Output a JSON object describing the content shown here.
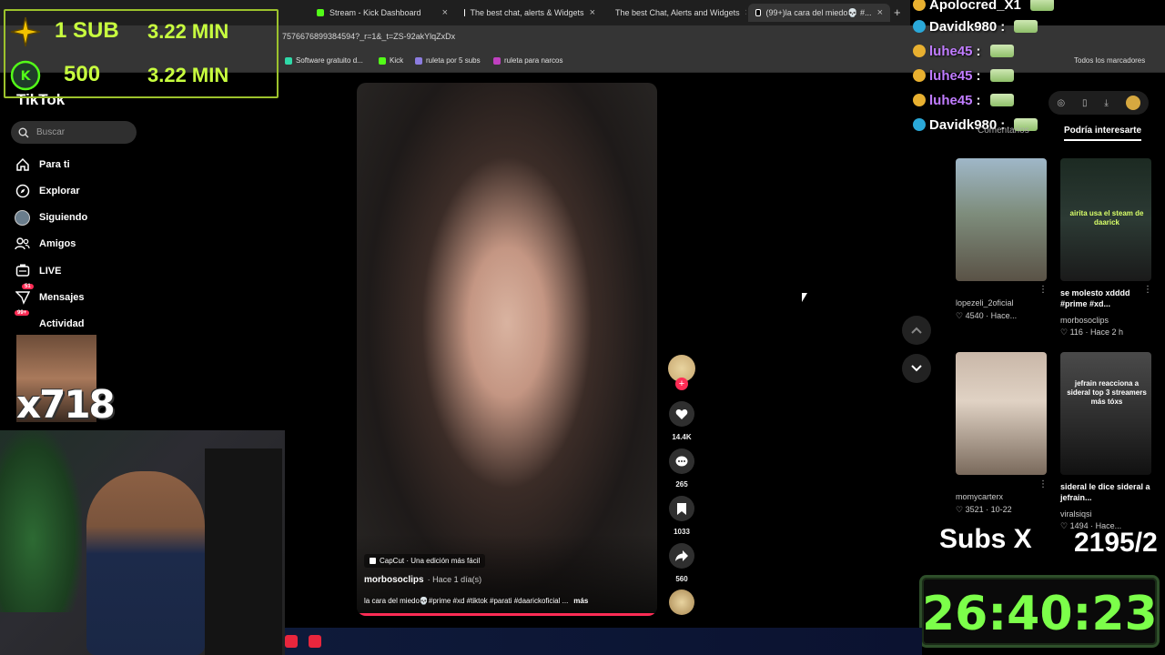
{
  "browser": {
    "tabs": [
      {
        "label": "Stream - Kick Dashboard",
        "color": "#53fc18"
      },
      {
        "label": "The best chat, alerts & Widgets",
        "color": "#ffffff"
      },
      {
        "label": "The best Chat, Alerts and Widgets",
        "color": "#ffffff"
      },
      {
        "label": "(99+)la cara del miedo💀 #...",
        "color": "#ffffff"
      }
    ],
    "url": "7576676899384594?_r=1&_t=ZS-92akYlqZxDx",
    "bookmarks": [
      {
        "label": "Software gratuito d...",
        "color": "#2fd9a8"
      },
      {
        "label": "Kick",
        "color": "#53fc18"
      },
      {
        "label": "ruleta por 5 subs",
        "color": "#8c7ce0"
      },
      {
        "label": "ruleta para narcos",
        "color": "#c040c0"
      }
    ],
    "all_bookmarks": "Todos los marcadores"
  },
  "overlays": {
    "alert1": {
      "count": "1 SUB",
      "time": "3.22 MIN"
    },
    "alert2": {
      "count": "500",
      "time": "3.22 MIN"
    },
    "multiplier": "x718",
    "subs_label": "Subs X",
    "subs_count": "2195/2",
    "timer": "26:40:23"
  },
  "tiktok": {
    "logo": "TikTok",
    "search_placeholder": "Buscar",
    "nav": [
      {
        "label": "Para ti",
        "icon": "home-icon"
      },
      {
        "label": "Explorar",
        "icon": "compass-icon"
      },
      {
        "label": "Siguiendo",
        "icon": "following-icon"
      },
      {
        "label": "Amigos",
        "icon": "friends-icon"
      },
      {
        "label": "LIVE",
        "icon": "live-icon"
      },
      {
        "label": "Mensajes",
        "icon": "messages-icon",
        "badge": "51"
      },
      {
        "label": "Actividad",
        "icon": "activity-icon",
        "badge": "99+"
      }
    ],
    "video": {
      "capcut": "CapCut · Una edición más fácil",
      "author": "morbosoclips",
      "time": "· Hace 1 día(s)",
      "caption": "la cara del miedo💀#prime #xd #tiktok #parati #daarickoficial ...",
      "more": "más"
    },
    "actions": {
      "likes": "14.4K",
      "comments": "265",
      "saves": "1033",
      "shares": "560"
    },
    "right_tabs": [
      "Comentarios",
      "Podría interesarte"
    ],
    "suggestions": [
      {
        "title": "",
        "user": "lopezeli_2oficial",
        "likes": "4540",
        "when": "Hace...",
        "overlay": ""
      },
      {
        "title": "se molesto xdddd #prime #xd...",
        "user": "morbosoclips",
        "likes": "116",
        "when": "Hace 2 h",
        "overlay": "airita usa el steam de daarick"
      },
      {
        "title": "",
        "user": "momycarterx",
        "likes": "3521",
        "when": "10-22",
        "overlay": ""
      },
      {
        "title": "sideral le dice sideral a jefrain...",
        "user": "viralsiqsi",
        "likes": "1494",
        "when": "Hace...",
        "overlay": "jefrain reacciona a sideral top 3 streamers más tóxs"
      }
    ]
  },
  "chat": [
    {
      "user": "Apolocred_X1",
      "color": "#ffffff",
      "icon": "#e8b030"
    },
    {
      "user": "Davidk980",
      "color": "#ffffff",
      "icon": "#2aa8d8"
    },
    {
      "user": "luhe45",
      "color": "#c07cff",
      "icon": "#e8b030"
    },
    {
      "user": "luhe45",
      "color": "#c07cff",
      "icon": "#e8b030"
    },
    {
      "user": "luhe45",
      "color": "#c07cff",
      "icon": "#e8b030"
    },
    {
      "user": "Davidk980",
      "color": "#ffffff",
      "icon": "#2aa8d8"
    }
  ]
}
